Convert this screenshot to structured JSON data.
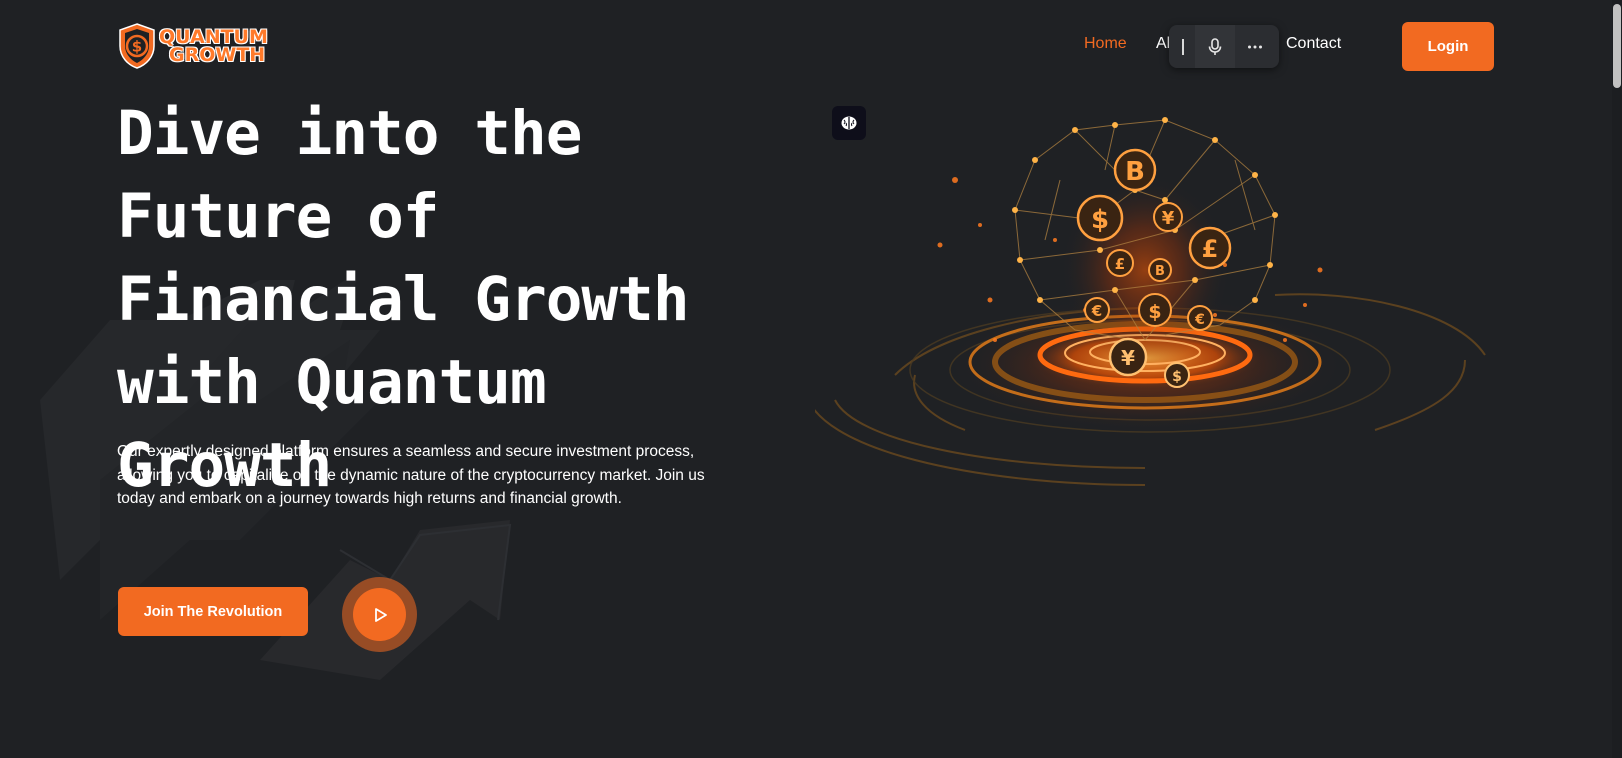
{
  "brand": {
    "name_line1": "QUANTUM",
    "name_line2": "GROWTH",
    "logo_icon": "dollar-shield-icon"
  },
  "nav": {
    "items": [
      {
        "label": "Home",
        "active": true
      },
      {
        "label": "About",
        "active": false
      },
      {
        "label": "Contact",
        "active": false
      }
    ],
    "login_label": "Login"
  },
  "toolbar": {
    "icons": [
      "text-cursor-icon",
      "microphone-icon",
      "more-icon"
    ]
  },
  "hero": {
    "title": "Dive into the Future of Financial Growth with Quantum Growth",
    "description": "Our expertly designed platform ensures a seamless and secure investment process, allowing you to capitalize on the dynamic nature of the cryptocurrency market. Join us today and embark on a journey towards high returns and financial growth.",
    "cta_label": "Join The Revolution",
    "play_icon": "play-icon",
    "illustration_icons": [
      "bitcoin-icon",
      "dollar-icon",
      "yen-icon",
      "pound-icon",
      "euro-icon"
    ]
  },
  "extension_button": {
    "icon": "brain-icon"
  },
  "colors": {
    "background": "#1f2124",
    "accent": "#f26a21",
    "text": "#ffffff",
    "toolbar_bg": "#2b2d31"
  }
}
